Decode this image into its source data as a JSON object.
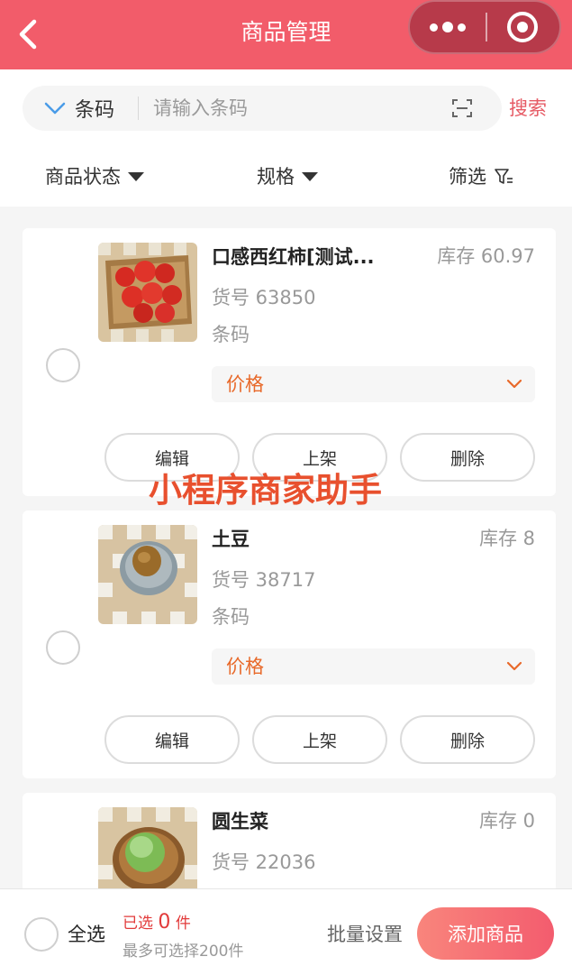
{
  "header": {
    "title": "商品管理"
  },
  "search": {
    "type_label": "条码",
    "placeholder": "请输入条码",
    "button_label": "搜索"
  },
  "filters": {
    "status_label": "商品状态",
    "spec_label": "规格",
    "filter_label": "筛选"
  },
  "products": [
    {
      "name": "口感西红柿[测试...",
      "stock": "库存 60.97",
      "sku": "货号 63850",
      "barcode": "条码",
      "price_label": "价格",
      "actions": [
        "编辑",
        "上架",
        "删除"
      ]
    },
    {
      "name": "土豆",
      "stock": "库存 8",
      "sku": "货号 38717",
      "barcode": "条码",
      "price_label": "价格",
      "actions": [
        "编辑",
        "上架",
        "删除"
      ]
    },
    {
      "name": "圆生菜",
      "stock": "库存 0",
      "sku": "货号 22036"
    }
  ],
  "watermark": "小程序商家助手",
  "bottom": {
    "select_all": "全选",
    "selected_prefix": "已选",
    "selected_count": "0",
    "selected_suffix": "件",
    "max_note": "最多可选择200件",
    "batch_label": "批量设置",
    "add_label": "添加商品"
  },
  "colors": {
    "header_bg": "#f25c6a",
    "accent": "#e65a64",
    "price": "#e8692a",
    "watermark": "#e8502e"
  }
}
